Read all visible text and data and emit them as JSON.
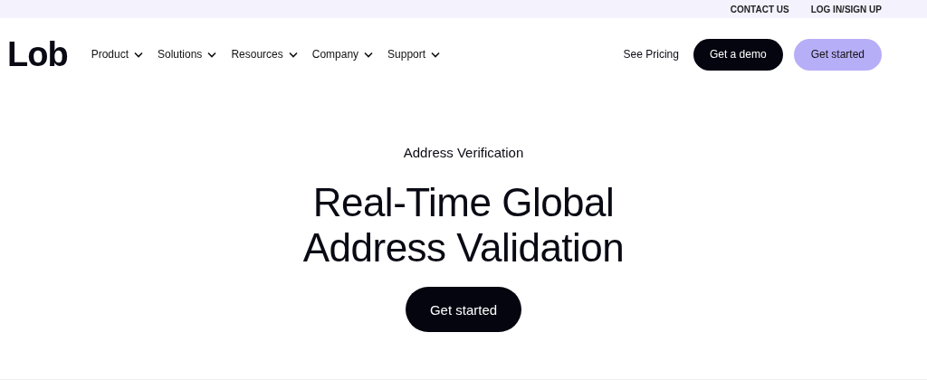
{
  "top_bar": {
    "links": [
      "CONTACT US",
      "LOG IN/SIGN UP"
    ]
  },
  "nav": {
    "logo": "Lob",
    "menu": [
      "Product",
      "Solutions",
      "Resources",
      "Company",
      "Support"
    ],
    "pricing_link": "See Pricing",
    "demo_button": "Get a demo",
    "start_button": "Get started"
  },
  "hero": {
    "eyebrow": "Address Verification",
    "title_lines": [
      "Real-Time Global",
      "Address Validation"
    ],
    "button": "Get started"
  }
}
